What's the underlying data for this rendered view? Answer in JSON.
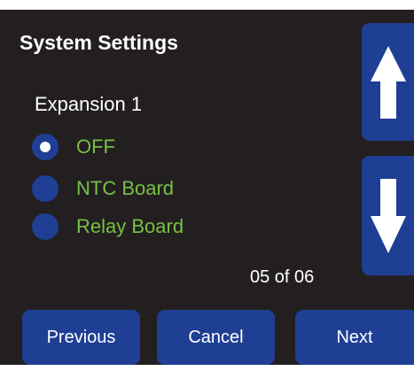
{
  "header": {
    "title": "System Settings",
    "subtitle": "Expansion 1"
  },
  "options": [
    {
      "label": "OFF",
      "selected": true
    },
    {
      "label": "NTC Board",
      "selected": false
    },
    {
      "label": "Relay Board",
      "selected": false
    }
  ],
  "pagination": {
    "text": "05 of 06"
  },
  "scroll": {
    "up_icon": "arrow-up-icon",
    "down_icon": "arrow-down-icon"
  },
  "footer": {
    "previous_label": "Previous",
    "cancel_label": "Cancel",
    "next_label": "Next"
  },
  "colors": {
    "background": "#231f20",
    "button": "#1f3f94",
    "option_text": "#76c043",
    "text": "#ffffff"
  }
}
